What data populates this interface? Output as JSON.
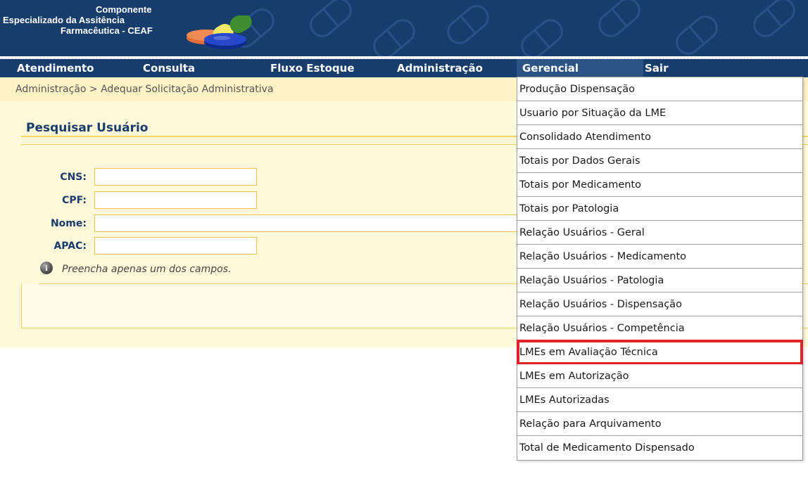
{
  "header": {
    "logo_line1": "Componente",
    "logo_line2": "Especializado da Assitência",
    "logo_line3": "Farmacêutica - CEAF"
  },
  "nav": {
    "items": [
      {
        "label": "Atendimento"
      },
      {
        "label": "Consulta"
      },
      {
        "label": "Fluxo Estoque"
      },
      {
        "label": "Administração"
      },
      {
        "label": "Gerencial"
      },
      {
        "label": "Sair"
      }
    ],
    "active": "Gerencial"
  },
  "breadcrumb": "Administração > Adequar Solicitação Administrativa",
  "search": {
    "title": "Pesquisar Usuário",
    "fields": [
      {
        "label": "CNS:",
        "value": ""
      },
      {
        "label": "CPF:",
        "value": ""
      },
      {
        "label": "Nome:",
        "value": ""
      },
      {
        "label": "APAC:",
        "value": ""
      }
    ],
    "hint": "Preencha apenas um dos campos."
  },
  "dropdown": {
    "items": [
      {
        "label": "Produção Dispensação"
      },
      {
        "label": "Usuario por Situação da LME"
      },
      {
        "label": "Consolidado Atendimento"
      },
      {
        "label": "Totais por Dados Gerais"
      },
      {
        "label": "Totais por Medicamento"
      },
      {
        "label": "Totais por Patologia"
      },
      {
        "label": "Relação Usuários - Geral"
      },
      {
        "label": "Relação Usuários - Medicamento"
      },
      {
        "label": "Relação Usuários - Patologia"
      },
      {
        "label": "Relação Usuários - Dispensação"
      },
      {
        "label": "Relação Usuários - Competência"
      },
      {
        "label": "LMEs em Avaliação Técnica"
      },
      {
        "label": "LMEs em Autorização"
      },
      {
        "label": "LMEs Autorizadas"
      },
      {
        "label": "Relação para Arquivamento"
      },
      {
        "label": "Total de Medicamento Dispensado"
      }
    ],
    "highlighted": "LMEs em Avaliação Técnica"
  },
  "colors": {
    "navy": "#173d6c",
    "panel": "#fff8d9",
    "highlight_border": "#e0232b"
  },
  "icons": {
    "hint": "info-icon",
    "logo": "pills-logo"
  }
}
